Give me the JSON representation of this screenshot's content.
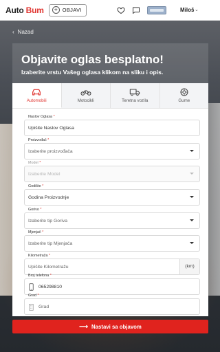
{
  "header": {
    "logo_part1": "Auto",
    "logo_part2": "Bum",
    "post_button": "OBJAVI",
    "user_name": "Miloš"
  },
  "nav": {
    "back_label": "Nazad"
  },
  "hero": {
    "title": "Objavite oglas besplatno!",
    "subtitle": "Izaberite vrstu Vašeg oglasa klikom na sliku i opis."
  },
  "tabs": [
    {
      "label": "Automobili",
      "icon": "car-icon",
      "active": true
    },
    {
      "label": "Motocikli",
      "icon": "motorcycle-icon",
      "active": false
    },
    {
      "label": "Teretna vozila",
      "icon": "truck-icon",
      "active": false
    },
    {
      "label": "Gume",
      "icon": "tire-icon",
      "active": false
    }
  ],
  "form": {
    "title": {
      "label": "Naslov Oglasa",
      "placeholder": "Upišite Naslov Oglasa"
    },
    "manufacturer": {
      "label": "Proizvođač",
      "placeholder": "Izaberite proizvođača"
    },
    "model": {
      "label": "Model",
      "placeholder": "Izaberite Model"
    },
    "year": {
      "label": "Godište",
      "placeholder": "Godina Proizvodnje"
    },
    "fuel": {
      "label": "Gorivo",
      "placeholder": "Izaberite tip Goriva"
    },
    "transmission": {
      "label": "Mjenjač",
      "placeholder": "Izaberite tip Mjenjača"
    },
    "mileage": {
      "label": "Kilometraža",
      "placeholder": "Upišite Kilometražu",
      "unit": "(km)"
    },
    "phone": {
      "label": "Broj telefona",
      "value": "065298810"
    },
    "city": {
      "label": "Grad",
      "placeholder": "Grad"
    },
    "required_mark": "*"
  },
  "submit_label": "Nastavi sa objavom",
  "colors": {
    "accent": "#e0231e",
    "brand_red": "#e0342f"
  }
}
